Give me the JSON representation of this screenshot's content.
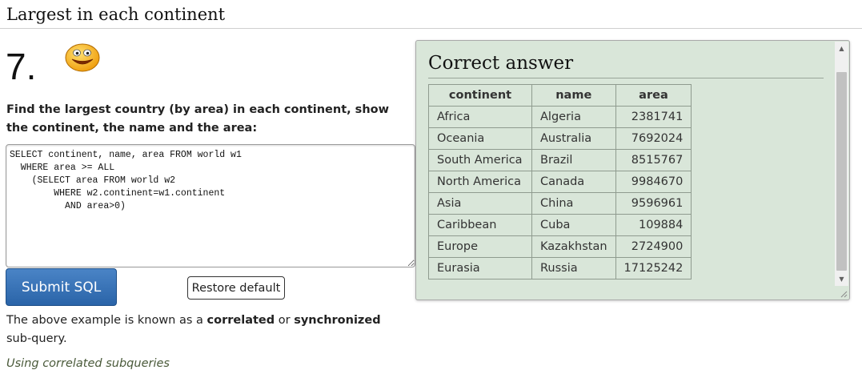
{
  "page": {
    "title": "Largest in each continent"
  },
  "question": {
    "number": "7.",
    "icon": "smiley-icon",
    "text": "Find the largest country (by area) in each continent, show the continent, the name and the area:",
    "sql": "SELECT continent, name, area FROM world w1\n  WHERE area >= ALL\n    (SELECT area FROM world w2\n        WHERE w2.continent=w1.continent\n          AND area>0)"
  },
  "buttons": {
    "submit": "Submit SQL",
    "restore": "Restore default"
  },
  "note": {
    "part1": "The above example is known as a ",
    "bold1": "correlated",
    "part2": " or ",
    "bold2": "synchronized",
    "part3": " sub-query."
  },
  "link": {
    "text": "Using correlated subqueries"
  },
  "answer": {
    "title": "Correct answer",
    "headers": {
      "continent": "continent",
      "name": "name",
      "area": "area"
    },
    "rows": [
      {
        "continent": "Africa",
        "name": "Algeria",
        "area": "2381741"
      },
      {
        "continent": "Oceania",
        "name": "Australia",
        "area": "7692024"
      },
      {
        "continent": "South America",
        "name": "Brazil",
        "area": "8515767"
      },
      {
        "continent": "North America",
        "name": "Canada",
        "area": "9984670"
      },
      {
        "continent": "Asia",
        "name": "China",
        "area": "9596961"
      },
      {
        "continent": "Caribbean",
        "name": "Cuba",
        "area": "109884"
      },
      {
        "continent": "Europe",
        "name": "Kazakhstan",
        "area": "2724900"
      },
      {
        "continent": "Eurasia",
        "name": "Russia",
        "area": "17125242"
      }
    ]
  },
  "colors": {
    "submit_button": "#3571b8",
    "answer_panel_bg": "#d9e6d9",
    "link": "#4a5a3a"
  }
}
